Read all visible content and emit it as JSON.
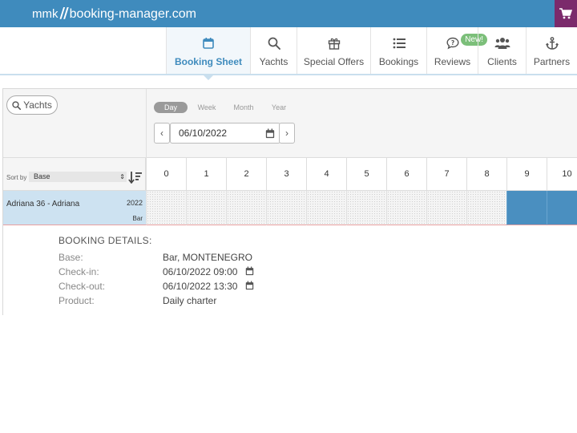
{
  "header": {
    "logo_prefix": "mmk",
    "logo_mark": "//",
    "logo_text": "booking-manager.com",
    "cart_icon": "shopping-cart-icon",
    "bar_color": "#3f8bbd"
  },
  "nav": {
    "items": [
      {
        "label": "Booking Sheet",
        "icon": "calendar-icon",
        "active": true
      },
      {
        "label": "Yachts",
        "icon": "search-icon"
      },
      {
        "label": "Special Offers",
        "icon": "gift-icon"
      },
      {
        "label": "Bookings",
        "icon": "list-icon"
      },
      {
        "label": "Reviews",
        "icon": "comment-question-icon",
        "badge": "New!"
      },
      {
        "label": "Clients",
        "icon": "users-icon"
      },
      {
        "label": "Partners",
        "icon": "anchor-icon"
      }
    ]
  },
  "toolbar": {
    "yachts_button": "Yachts",
    "periods": [
      "Day",
      "Week",
      "Month",
      "Year"
    ],
    "active_period": "Day",
    "date_value": "06/10/2022",
    "prev_label": "‹",
    "next_label": "›"
  },
  "sort": {
    "label": "Sort by",
    "selected": "Base"
  },
  "hours": [
    "0",
    "1",
    "2",
    "3",
    "4",
    "5",
    "6",
    "7",
    "8",
    "9",
    "10"
  ],
  "yacht": {
    "name": "Adriana 36 - Adriana",
    "year": "2022",
    "base": "Bar",
    "booked_from_hour": 9
  },
  "details": {
    "title": "BOOKING DETAILS:",
    "rows": [
      {
        "label": "Base:",
        "value": "Bar, MONTENEGRO"
      },
      {
        "label": "Check-in:",
        "value": "06/10/2022 09:00"
      },
      {
        "label": "Check-out:",
        "value": "06/10/2022 13:30"
      },
      {
        "label": "Product:",
        "value": "Daily charter"
      }
    ]
  },
  "colors": {
    "accent": "#3f8bbd",
    "booked": "#4a8fc0",
    "new_badge": "#7cbf7a",
    "cart": "#7b2a6b"
  }
}
